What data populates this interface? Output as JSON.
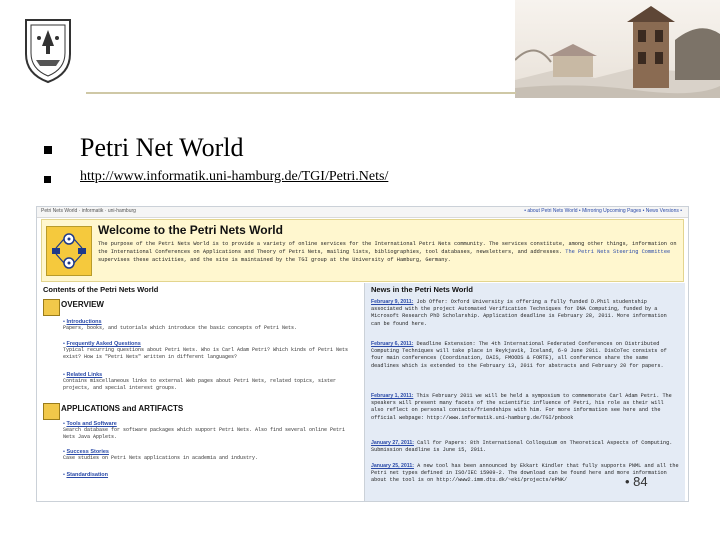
{
  "slide": {
    "bullets": [
      {
        "text": "Petri Net World"
      },
      {
        "text": "http://www.informatik.uni-hamburg.de/TGI/Petri.Nets/"
      }
    ],
    "page_number": "• 84",
    "colors": {
      "rule": "#cfc8a6",
      "link": "#2a4aa8",
      "header_bg": "#fff7cf",
      "news_bg": "#e4ebf5"
    }
  },
  "screenshot": {
    "top_left": "Petri Nets World · informatik · uni-hamburg",
    "top_links": "• about Petri Nets World • Mirroring Upcoming Pages • News Versions •",
    "header_title": "Welcome to the Petri Nets World",
    "header_text_1": "The purpose of the Petri Nets World is to provide a variety of online services for the International Petri Nets community. The services constitute, among other things, information on the International Conferences on Applications and Theory of Petri Nets, mailing lists, bibliographies, tool databases, newsletters, and addresses.",
    "header_link": "The Petri Nets Steering Committee",
    "header_text_2": "supervises these activities, and the site is maintained by the TGI group at the University of Hamburg, Germany.",
    "contents_title": "Contents of the Petri Nets World",
    "sections": [
      {
        "title": "OVERVIEW",
        "items": [
          {
            "link": "Introductions",
            "desc": "Papers, books, and tutorials which introduce the basic concepts of Petri Nets."
          },
          {
            "link": "Frequently Asked Questions",
            "desc": "Typical recurring questions about Petri Nets. Who is Carl Adam Petri? Which kinds of Petri Nets exist? How is \"Petri Nets\" written in different languages?"
          },
          {
            "link": "Related Links",
            "desc": "Contains miscellaneous links to external Web pages about Petri Nets, related topics, sister projects, and special interest groups."
          }
        ]
      },
      {
        "title": "APPLICATIONS and ARTIFACTS",
        "items": [
          {
            "link": "Tools and Software",
            "desc": "Search database for software packages which support Petri Nets. Also find several online Petri Nets Java Applets."
          },
          {
            "link": "Success Stories",
            "desc": "Case studies on Petri Nets applications in academia and industry."
          },
          {
            "link": "Standardisation",
            "desc": ""
          }
        ]
      }
    ],
    "news_title": "News in the Petri Nets World",
    "news": [
      {
        "date": "February 9, 2011:",
        "text": "Job Offer: Oxford University is offering a fully funded D.Phil studentship associated with the project Automated Verification Techniques for DNA Computing, funded by a Microsoft Research PhD Scholarship. Application deadline is February 28, 2011. More information can be found here."
      },
      {
        "date": "February 6, 2011:",
        "text": "Deadline Extension: The 4th International Federated Conferences on Distributed Computing Techniques will take place in Reykjavik, Iceland, 6-9 June 2011. DisCoTec consists of four main conferences (Coordination, DAIS, FMOODS & FORTE), all conference share the same deadlines which is extended to the February 13, 2011 for abstracts and February 20 for papers."
      },
      {
        "date": "February 1, 2011:",
        "text": "This February 2011 we will be held a symposium to commemorate Carl Adam Petri. The speakers will present many facets of the scientific influence of Petri, his role as their will also reflect on personal contacts/friendships with him. For more information see here and the official webpage: http://www.informatik.uni-hamburg.de/TGI/pnbook"
      },
      {
        "date": "January 27, 2011:",
        "text": "Call for Papers: 8th International Colloquium on Theoretical Aspects of Computing. Submission deadline is June 15, 2011."
      },
      {
        "date": "January 25, 2011:",
        "text": "A new tool has been announced by Ekkart Kindler that fully supports PNML and all the Petri net types defined in ISO/IEC 15909-2. The download can be found here and more information about the tool is on http://www2.imm.dtu.dk/~eki/projects/ePNK/"
      }
    ]
  }
}
